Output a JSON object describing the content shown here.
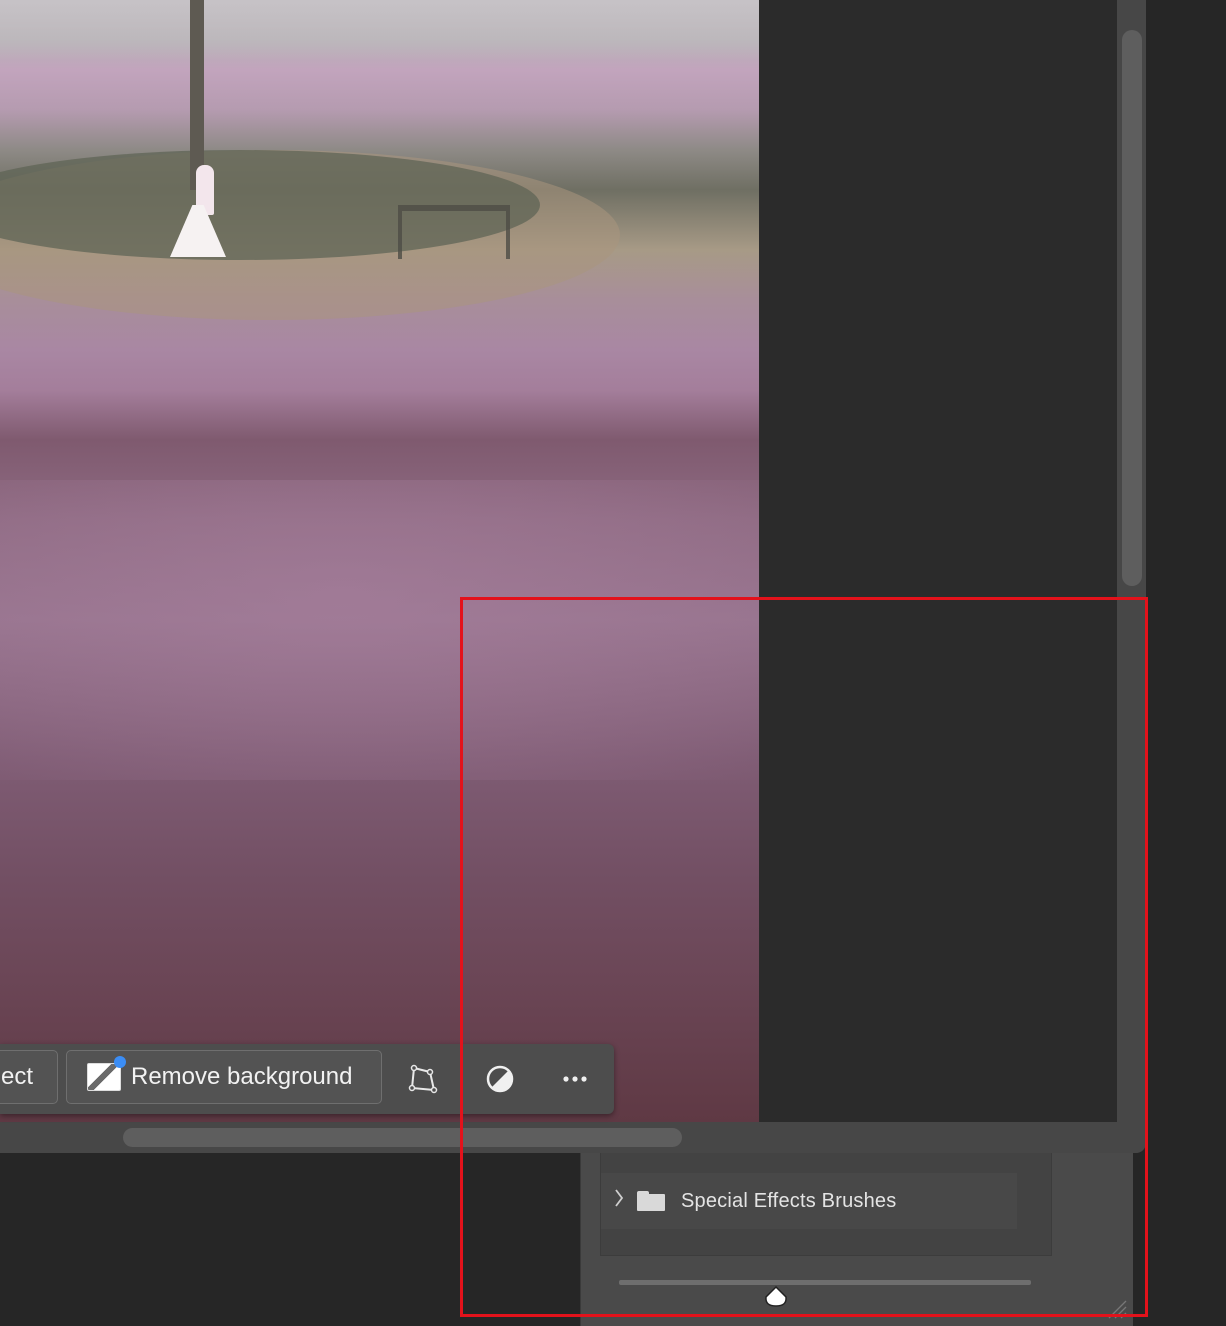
{
  "taskbar": {
    "select_subject_label": "ect",
    "remove_background_label": "Remove background"
  },
  "brushes_panel": {
    "folder_label": "Special Effects Brushes"
  },
  "colors": {
    "annotation": "#e3121b",
    "accent_dot": "#3b8df5"
  },
  "icons": {
    "remove_background": "image-remove-bg-icon",
    "transform": "transform-icon",
    "adjust": "adjustment-icon",
    "more": "more-options-icon",
    "folder": "folder-icon",
    "expand": "chevron-right-icon"
  }
}
